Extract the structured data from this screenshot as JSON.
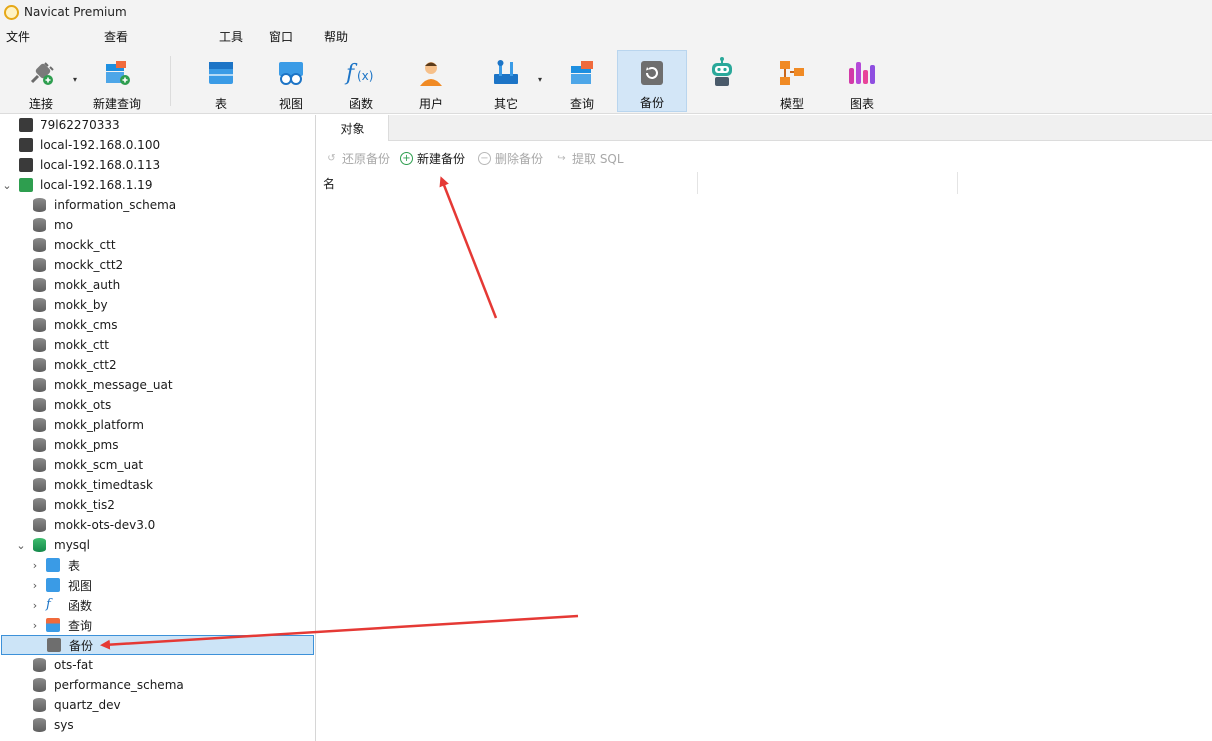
{
  "window": {
    "title": "Navicat Premium"
  },
  "menu": [
    "文件",
    "查看",
    "工具",
    "窗口",
    "帮助"
  ],
  "toolbar": {
    "buttons": [
      {
        "id": "connect",
        "label": "连接",
        "icon": "plug-icon"
      },
      {
        "id": "new-query",
        "label": "新建查询",
        "icon": "new-query-icon"
      },
      {
        "id": "table",
        "label": "表",
        "icon": "table-icon"
      },
      {
        "id": "view",
        "label": "视图",
        "icon": "view-icon"
      },
      {
        "id": "function",
        "label": "函数",
        "icon": "function-icon"
      },
      {
        "id": "user",
        "label": "用户",
        "icon": "user-icon"
      },
      {
        "id": "other",
        "label": "其它",
        "icon": "tools-icon"
      },
      {
        "id": "query",
        "label": "查询",
        "icon": "query-icon"
      },
      {
        "id": "backup",
        "label": "备份",
        "icon": "backup-icon",
        "active": true
      },
      {
        "id": "automation",
        "label": "",
        "icon": "robot-icon"
      },
      {
        "id": "model",
        "label": "模型",
        "icon": "model-icon"
      },
      {
        "id": "chart",
        "label": "图表",
        "icon": "chart-icon"
      }
    ]
  },
  "sidebar": {
    "connections": [
      {
        "label": "79l62270333",
        "open": false
      },
      {
        "label": "local-192.168.0.100",
        "open": false
      },
      {
        "label": "local-192.168.0.113",
        "open": false
      },
      {
        "label": "local-192.168.1.19",
        "open": true
      }
    ],
    "databases": [
      "information_schema",
      "mo",
      "mockk_ctt",
      "mockk_ctt2",
      "mokk_auth",
      "mokk_by",
      "mokk_cms",
      "mokk_ctt",
      "mokk_ctt2",
      "mokk_message_uat",
      "mokk_ots",
      "mokk_platform",
      "mokk_pms",
      "mokk_scm_uat",
      "mokk_timedtask",
      "mokk_tis2",
      "mokk-ots-dev3.0"
    ],
    "open_database": "mysql",
    "mysql_children": [
      {
        "label": "表",
        "icon": "table-icon"
      },
      {
        "label": "视图",
        "icon": "view-icon"
      },
      {
        "label": "函数",
        "icon": "function-icon"
      },
      {
        "label": "查询",
        "icon": "query-icon"
      },
      {
        "label": "备份",
        "icon": "backup-icon",
        "selected": true
      }
    ],
    "after": [
      "ots-fat",
      "performance_schema",
      "quartz_dev",
      "sys"
    ]
  },
  "content": {
    "tab": "对象",
    "actions": [
      {
        "label": "还原备份",
        "enabled": false,
        "icon": "restore-icon"
      },
      {
        "label": "新建备份",
        "enabled": true,
        "icon": "plus-circle-icon"
      },
      {
        "label": "删除备份",
        "enabled": false,
        "icon": "minus-circle-icon"
      },
      {
        "label": "提取 SQL",
        "enabled": false,
        "icon": "extract-icon"
      }
    ],
    "columns": [
      "名"
    ]
  },
  "colors": {
    "accent": "#3c91d9",
    "arrow": "#e53935",
    "selected_bg": "#cce4f7",
    "active_tool": "#d3e6f7"
  }
}
